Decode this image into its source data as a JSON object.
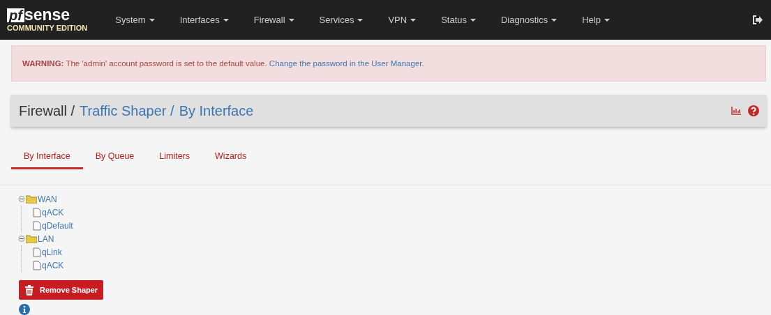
{
  "logo": {
    "mark": "pf",
    "word": "sense",
    "edition": "COMMUNITY EDITION"
  },
  "nav": [
    {
      "label": "System"
    },
    {
      "label": "Interfaces"
    },
    {
      "label": "Firewall"
    },
    {
      "label": "Services"
    },
    {
      "label": "VPN"
    },
    {
      "label": "Status"
    },
    {
      "label": "Diagnostics"
    },
    {
      "label": "Help"
    }
  ],
  "alert": {
    "text": "**WARNING:** The 'admin' account password is set to the default value.",
    "link": "Change the password in the User Manager."
  },
  "breadcrumb": [
    {
      "label": "Firewall /",
      "kind": "text"
    },
    {
      "label": "Traffic Shaper /",
      "kind": "link"
    },
    {
      "label": "By Interface",
      "kind": "link"
    }
  ],
  "tabs": [
    {
      "label": "By Interface",
      "selected": true
    },
    {
      "label": "By Queue",
      "selected": false
    },
    {
      "label": "Limiters",
      "selected": false
    },
    {
      "label": "Wizards",
      "selected": false
    }
  ],
  "tree": [
    {
      "label": "WAN",
      "expanded": true,
      "children": [
        {
          "label": "qACK"
        },
        {
          "label": "qDefault"
        }
      ]
    },
    {
      "label": "LAN",
      "expanded": true,
      "children": [
        {
          "label": "qLink"
        },
        {
          "label": "qACK"
        }
      ]
    }
  ],
  "remove_button": "Remove Shaper"
}
